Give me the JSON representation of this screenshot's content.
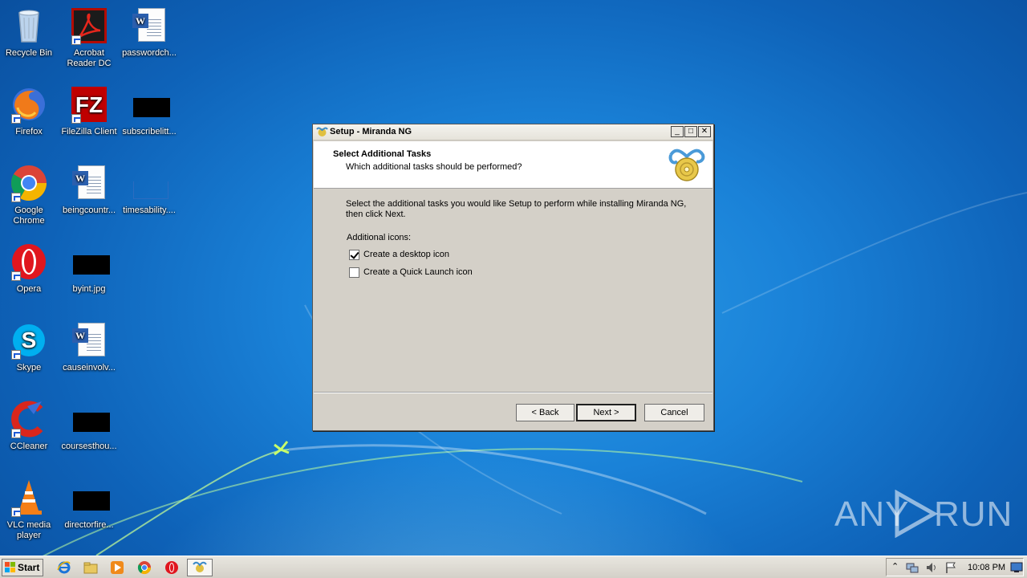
{
  "desktop": {
    "icons": [
      {
        "label": "Recycle Bin"
      },
      {
        "label": "Acrobat Reader DC"
      },
      {
        "label": "passwordch..."
      },
      {
        "label": "Firefox"
      },
      {
        "label": "FileZilla Client"
      },
      {
        "label": "subscribelitt..."
      },
      {
        "label": "Google Chrome"
      },
      {
        "label": "beingcountr..."
      },
      {
        "label": "timesability...."
      },
      {
        "label": "Opera"
      },
      {
        "label": "byint.jpg"
      },
      {
        "label": "Skype"
      },
      {
        "label": "causeinvolv..."
      },
      {
        "label": "CCleaner"
      },
      {
        "label": "coursesthou..."
      },
      {
        "label": "VLC media player"
      },
      {
        "label": "directorfire..."
      }
    ]
  },
  "dialog": {
    "title": "Setup - Miranda NG",
    "header_title": "Select Additional Tasks",
    "header_subtitle": "Which additional tasks should be performed?",
    "description_line1": "Select the additional tasks you would like Setup to perform while installing Miranda NG,",
    "description_line2": "then click Next.",
    "group_label": "Additional icons:",
    "tasks": [
      {
        "label": "Create a desktop icon",
        "checked": true
      },
      {
        "label": "Create a Quick Launch icon",
        "checked": false
      }
    ],
    "buttons": {
      "back": "< Back",
      "next": "Next >",
      "cancel": "Cancel"
    }
  },
  "taskbar": {
    "start_label": "Start",
    "clock": "10:08 PM"
  },
  "watermark": {
    "left": "ANY",
    "right": "RUN"
  },
  "colors": {
    "desktop_blue": "#1a82d8",
    "dialog_face": "#d4d0c8",
    "accent_blue": "#2b5fae"
  }
}
